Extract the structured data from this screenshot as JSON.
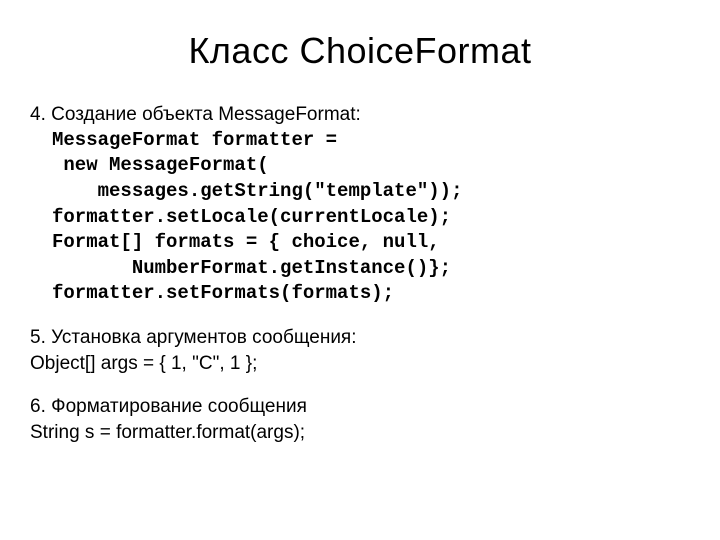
{
  "title": "Класс ChoiceFormat",
  "section4": {
    "header": "4. Создание объекта MessageFormat:",
    "code": "MessageFormat formatter =\n new MessageFormat(\n    messages.getString(\"template\"));\nformatter.setLocale(currentLocale);\nFormat[] formats = { choice, null,\n       NumberFormat.getInstance()};\nformatter.setFormats(formats);"
  },
  "section5": {
    "header": "5. Установка аргументов сообщения:",
    "line": "Object[] args = { 1, \"C\", 1 };"
  },
  "section6": {
    "header": "6. Форматирование сообщения",
    "line": "String s = formatter.format(args);"
  }
}
